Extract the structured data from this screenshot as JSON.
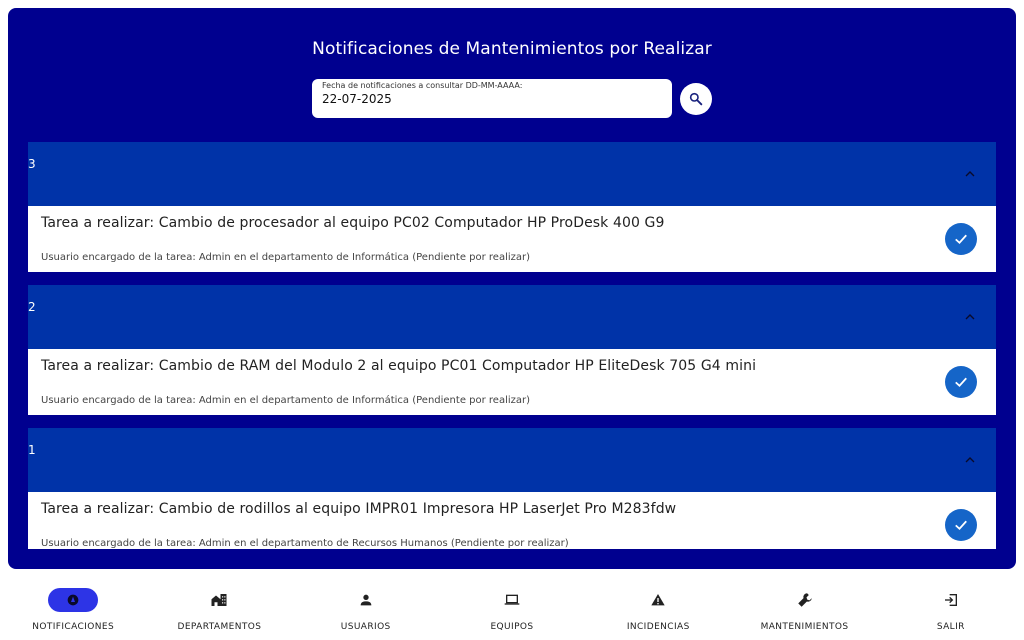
{
  "header": {
    "title": "Notificaciones de Mantenimientos por Realizar"
  },
  "date_filter": {
    "label": "Fecha de notificaciones a consultar DD-MM-AAAA:",
    "value": "22-07-2025",
    "search_icon": "search-icon"
  },
  "groups": [
    {
      "number": "3",
      "task_title": "Tarea a realizar: Cambio de procesador al equipo PC02 Computador HP ProDesk 400 G9",
      "task_user": "Usuario encargado de la tarea: Admin en el departamento de Informática (Pendiente por realizar)"
    },
    {
      "number": "2",
      "task_title": "Tarea a realizar: Cambio de RAM del Modulo 2 al equipo PC01 Computador HP EliteDesk 705 G4 mini",
      "task_user": "Usuario encargado de la tarea: Admin en el departamento de Informática (Pendiente por realizar)"
    },
    {
      "number": "1",
      "task_title": "Tarea a realizar: Cambio de rodillos al equipo IMPR01 Impresora HP LaserJet Pro M283fdw",
      "task_user": "Usuario encargado de la tarea: Admin en el departamento de Recursos Humanos (Pendiente por realizar)"
    }
  ],
  "nav": [
    {
      "label": "NOTIFICACIONES",
      "icon": "notification-icon",
      "active": true
    },
    {
      "label": "DEPARTAMENTOS",
      "icon": "buildings-icon"
    },
    {
      "label": "USUARIOS",
      "icon": "person-icon"
    },
    {
      "label": "EQUIPOS",
      "icon": "laptop-icon"
    },
    {
      "label": "INCIDENCIAS",
      "icon": "warning-icon"
    },
    {
      "label": "MANTENIMIENTOS",
      "icon": "wrench-icon"
    },
    {
      "label": "SALIR",
      "icon": "exit-icon"
    }
  ],
  "colors": {
    "background_panel": "#00008f",
    "group_header": "#0033a8",
    "check_button": "#1565c8",
    "nav_active": "#2d34e6"
  }
}
